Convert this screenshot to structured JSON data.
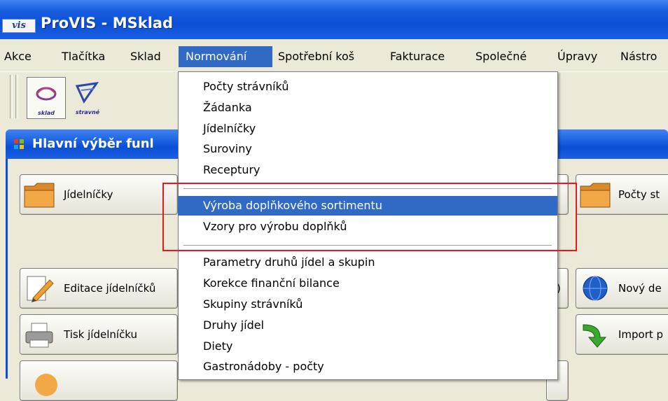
{
  "window": {
    "title": "ProVIS - MSklad",
    "logo_text": "vis"
  },
  "menubar": {
    "items": [
      {
        "label": "Akce"
      },
      {
        "label": "Tlačítka"
      },
      {
        "label": "Sklad"
      },
      {
        "label": "Normování"
      },
      {
        "label": "Spotřební koš"
      },
      {
        "label": "Fakturace"
      },
      {
        "label": "Společné"
      },
      {
        "label": "Úpravy"
      },
      {
        "label": "Nástro"
      }
    ],
    "active_index": 3
  },
  "toolbar": {
    "sklad_caption": "sklad",
    "stravne_caption": "stravné"
  },
  "inner_window": {
    "title": "Hlavní výběr funl"
  },
  "panel_buttons": [
    {
      "label": "Jídelníčky"
    },
    {
      "label": "Editace jídelníčků"
    },
    {
      "label": "Tisk jídelníčku"
    },
    {
      "label": "Počty st"
    },
    {
      "label": "Nový de"
    },
    {
      "label": "Import p"
    }
  ],
  "dropdown": {
    "items": [
      {
        "label": "Počty strávníků"
      },
      {
        "label": "Žádanka"
      },
      {
        "label": "Jídelníčky"
      },
      {
        "label": "Suroviny"
      },
      {
        "label": "Receptury"
      },
      {
        "label": "Výroba doplňkového sortimentu"
      },
      {
        "label": "Vzory pro výrobu doplňků"
      },
      {
        "label": "Parametry druhů jídel a skupin"
      },
      {
        "label": "Korekce finanční bilance"
      },
      {
        "label": "Skupiny strávníků"
      },
      {
        "label": "Druhy jídel"
      },
      {
        "label": "Diety"
      },
      {
        "label": "Gastronádoby - počty"
      }
    ],
    "highlighted_index": 5
  },
  "colors": {
    "xp_blue": "#0a4fd6",
    "highlight": "#316ac5",
    "annotation_red": "#e8181c",
    "face": "#ece9d8"
  }
}
